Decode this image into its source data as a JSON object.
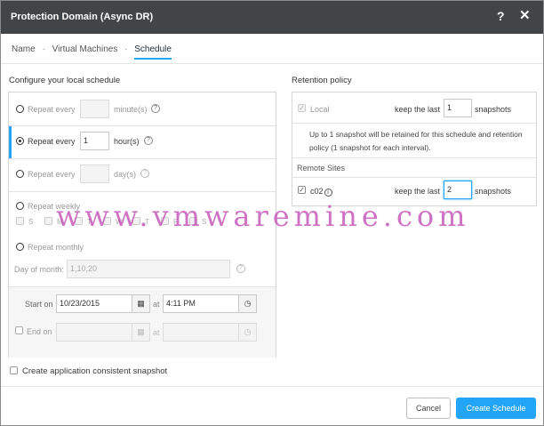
{
  "dialog": {
    "title": "Protection Domain (Async DR)",
    "help_label": "?",
    "close_label": "✕"
  },
  "steps": [
    {
      "label": "Name"
    },
    {
      "label": "Virtual Machines"
    },
    {
      "label": "Schedule"
    }
  ],
  "steps_separator": "·",
  "local_schedule": {
    "title": "Configure your local schedule",
    "repeat_minutes": {
      "label": "Repeat every",
      "value": "",
      "unit": "minute(s)",
      "selected": false
    },
    "repeat_hours": {
      "label": "Repeat every",
      "value": "1",
      "unit": "hour(s)",
      "selected": true
    },
    "repeat_days": {
      "label": "Repeat every",
      "value": "",
      "unit": "day(s)",
      "selected": false
    },
    "repeat_weekly": {
      "label": "Repeat weekly",
      "days": [
        "S",
        "M",
        "T",
        "W",
        "T",
        "F",
        "S"
      ]
    },
    "repeat_monthly": {
      "label": "Repeat monthly",
      "day_of_month_label": "Day of month:",
      "day_of_month_placeholder": "1,10,20"
    },
    "start_on": {
      "label": "Start on",
      "date": "10/23/2015",
      "at_label": "at",
      "time": "4:11 PM"
    },
    "end_on": {
      "label": "End on",
      "at_label": "at"
    },
    "help_label": "?"
  },
  "retention": {
    "title": "Retention policy",
    "local": {
      "label": "Local",
      "keep_label": "keep the last",
      "value": "1",
      "unit": "snapshots"
    },
    "info": "Up to 1 snapshot will be retained for this schedule and retention policy (1 snapshot for each interval).",
    "remote_sites_label": "Remote Sites",
    "remote": [
      {
        "label": "c02",
        "keep_label": "keep the last",
        "value": "2",
        "unit": "snapshots"
      }
    ]
  },
  "app_consistent_label": "Create application consistent snapshot",
  "buttons": {
    "cancel": "Cancel",
    "create": "Create Schedule"
  },
  "watermark": "www.vmwaremine.com",
  "icons": {
    "calendar": "calendar-icon",
    "clock": "clock-icon",
    "info": "info-icon"
  },
  "colors": {
    "titlebar": "#424548",
    "accent": "#22a5f7",
    "watermark": "#c24fb6"
  }
}
